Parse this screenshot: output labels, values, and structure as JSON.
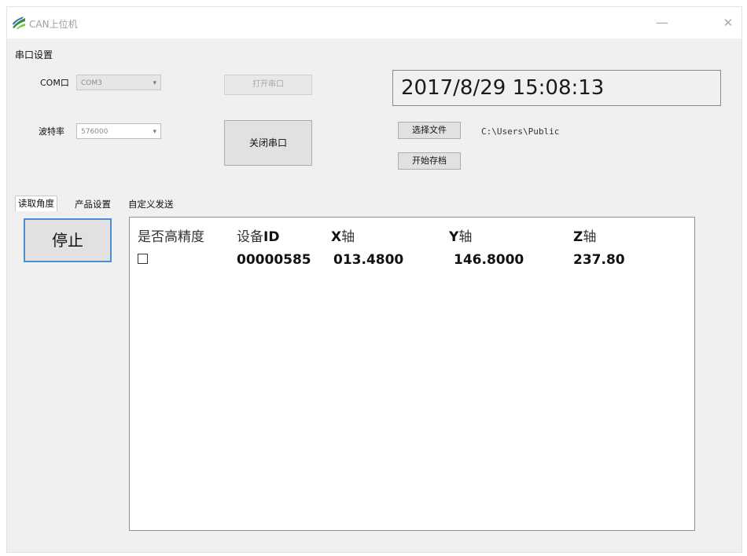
{
  "window": {
    "title": "CAN上位机",
    "minimize_glyph": "—",
    "close_glyph": "✕"
  },
  "serial": {
    "group_label": "串口设置",
    "com_label": "COM口",
    "com_value": "COM3",
    "baud_label": "波特率",
    "baud_value": "576000",
    "open_button": "打开串口",
    "close_button": "关闭串口"
  },
  "clock": {
    "text": "2017/8/29 15:08:13"
  },
  "file": {
    "choose_button": "选择文件",
    "path": "C:\\Users\\Public",
    "start_save_button": "开始存档"
  },
  "tabs": [
    "读取角度",
    "产品设置",
    "自定义发送"
  ],
  "stop_button": "停止",
  "table": {
    "headers": {
      "high_precision": "是否高精度",
      "device_id_prefix": "设备",
      "device_id_suffix": "ID",
      "x_prefix": "X",
      "x_suffix": "轴",
      "y_prefix": "Y",
      "y_suffix": "轴",
      "z_prefix": "Z",
      "z_suffix": "轴"
    },
    "rows": [
      {
        "high_precision": false,
        "device_id": "00000585",
        "x": "013.4800",
        "y": "146.8000",
        "z": "237.80"
      }
    ]
  }
}
